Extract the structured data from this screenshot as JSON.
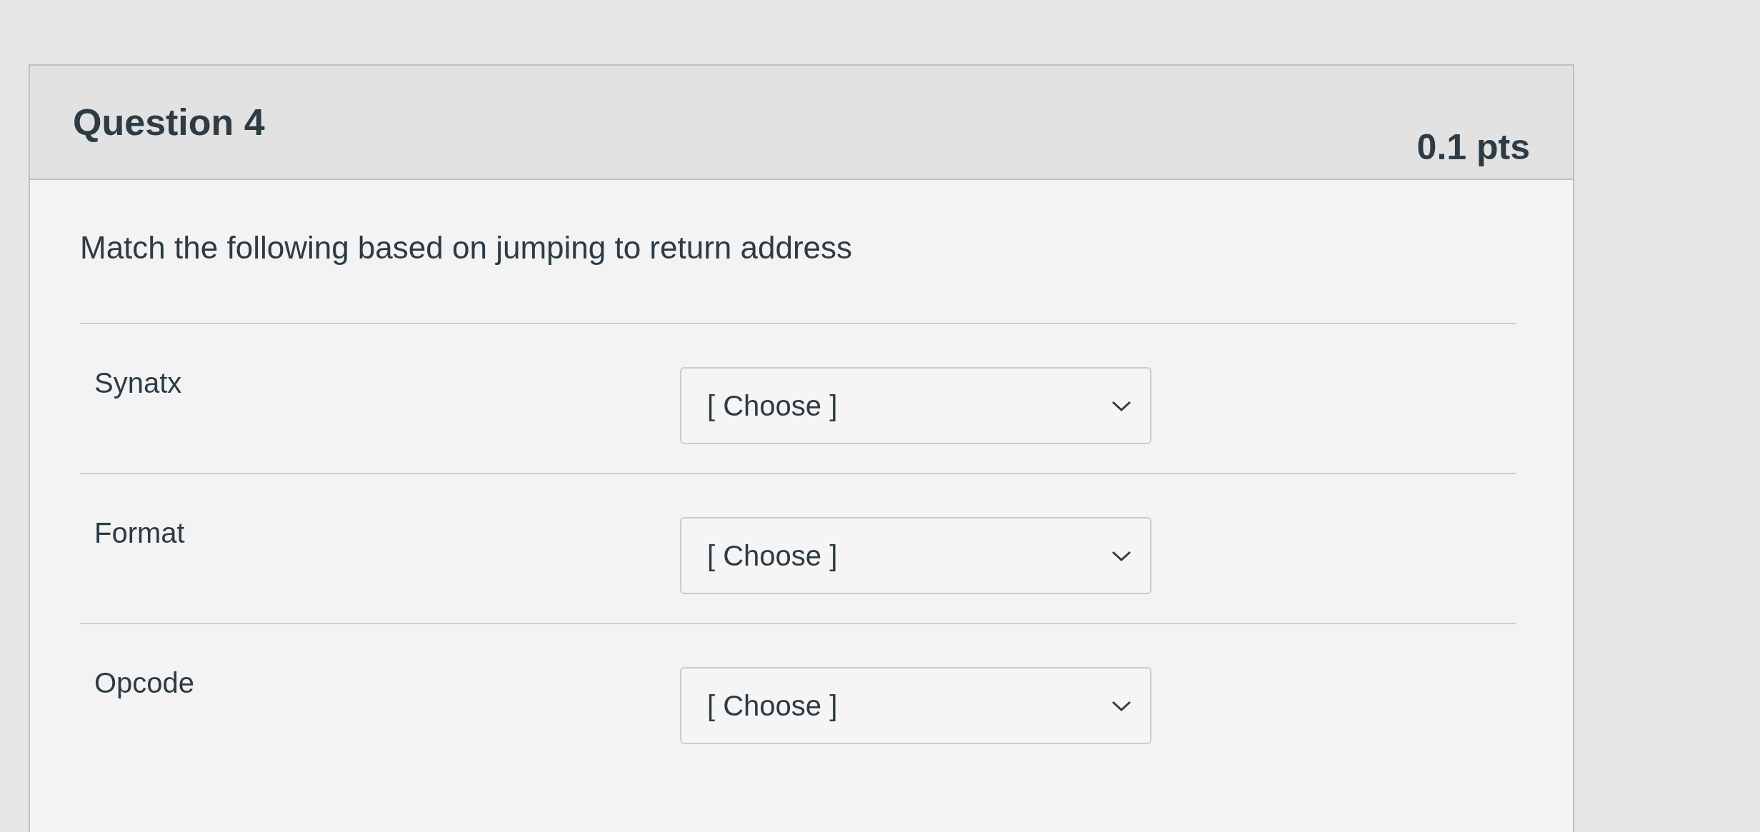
{
  "question": {
    "title": "Question 4",
    "points": "0.1 pts",
    "prompt": "Match the following based on jumping to return address",
    "matches": [
      {
        "label": "Synatx",
        "value": "[ Choose ]"
      },
      {
        "label": "Format",
        "value": "[ Choose ]"
      },
      {
        "label": "Opcode",
        "value": "[ Choose ]"
      }
    ]
  }
}
